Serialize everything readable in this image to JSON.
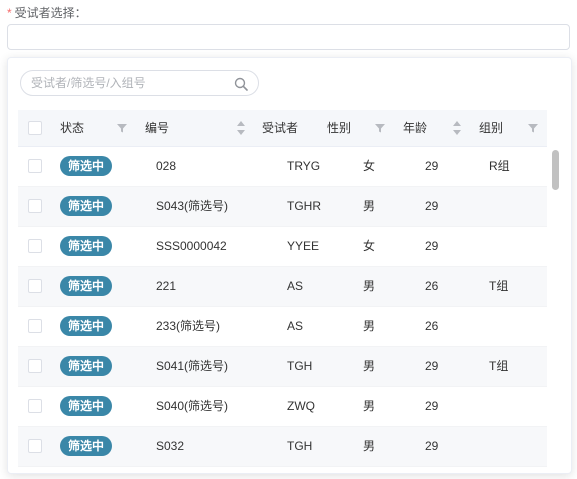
{
  "form": {
    "required_mark": "*",
    "label": "受试者选择："
  },
  "search": {
    "placeholder": "受试者/筛选号/入组号",
    "icon": "search-icon"
  },
  "table": {
    "headers": {
      "status": "状态",
      "number": "编号",
      "subject": "受试者",
      "gender": "性别",
      "age": "年龄",
      "group": "组别"
    },
    "rows": [
      {
        "status": "筛选中",
        "number": "028",
        "subject": "TRYG",
        "gender": "女",
        "age": "29",
        "group": "R组"
      },
      {
        "status": "筛选中",
        "number": "S043(筛选号)",
        "subject": "TGHR",
        "gender": "男",
        "age": "29",
        "group": ""
      },
      {
        "status": "筛选中",
        "number": "SSS0000042",
        "subject": "YYEE",
        "gender": "女",
        "age": "29",
        "group": ""
      },
      {
        "status": "筛选中",
        "number": "221",
        "subject": "AS",
        "gender": "男",
        "age": "26",
        "group": "T组"
      },
      {
        "status": "筛选中",
        "number": "233(筛选号)",
        "subject": "AS",
        "gender": "男",
        "age": "26",
        "group": ""
      },
      {
        "status": "筛选中",
        "number": "S041(筛选号)",
        "subject": "TGH",
        "gender": "男",
        "age": "29",
        "group": "T组"
      },
      {
        "status": "筛选中",
        "number": "S040(筛选号)",
        "subject": "ZWQ",
        "gender": "男",
        "age": "29",
        "group": ""
      },
      {
        "status": "筛选中",
        "number": "S032",
        "subject": "TGH",
        "gender": "男",
        "age": "29",
        "group": ""
      }
    ]
  },
  "colors": {
    "status_tag": "#3a87a8",
    "required": "#f56c6c"
  }
}
